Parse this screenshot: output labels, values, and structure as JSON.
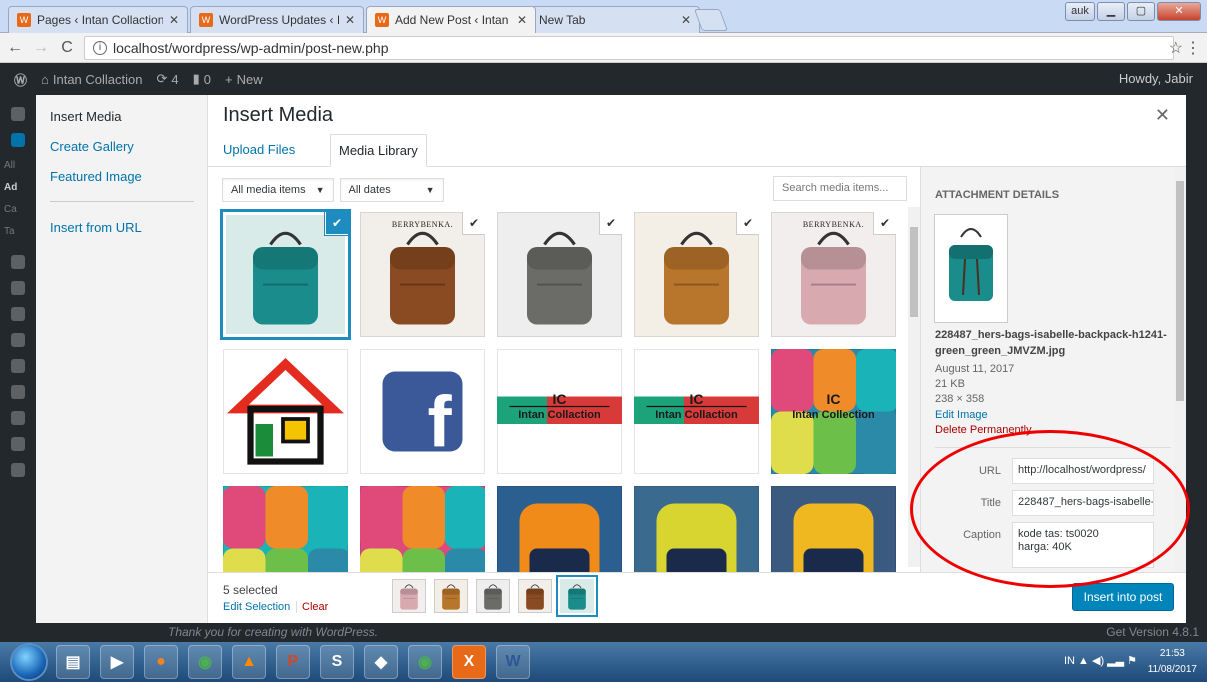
{
  "browser": {
    "tabs": [
      {
        "label": "Pages ‹ Intan Collaction -",
        "active": false
      },
      {
        "label": "WordPress Updates ‹ Inta",
        "active": false
      },
      {
        "label": "Add New Post ‹ Intan Co",
        "active": true
      },
      {
        "label": "New Tab",
        "active": false
      }
    ],
    "address": "localhost/wordpress/wp-admin/post-new.php",
    "profile_label": "auk"
  },
  "adminbar": {
    "site": "Intan Collaction",
    "updates": "4",
    "comments": "0",
    "new": "New",
    "howdy": "Howdy, Jabir"
  },
  "leftmenu_fragments": [
    "All",
    "Ad",
    "Ca",
    "Ta"
  ],
  "modal": {
    "title": "Insert Media",
    "sidebar": {
      "insert_media": "Insert Media",
      "create_gallery": "Create Gallery",
      "featured_image": "Featured Image",
      "insert_from_url": "Insert from URL"
    },
    "tabs": {
      "upload": "Upload Files",
      "library": "Media Library"
    },
    "filters": {
      "type": "All media items",
      "date": "All dates"
    },
    "search_placeholder": "Search media items...",
    "grid_items": [
      {
        "name": "isabelle-backpack-green",
        "bg": "#d8ebe9",
        "color": "#1a8c8c",
        "selected": true,
        "current": true
      },
      {
        "name": "berrybenka-brown-backpack",
        "bg": "#f2eeea",
        "color": "#8a4a22",
        "brand": "BERRYBENKA.",
        "selected": true
      },
      {
        "name": "grey-backpack",
        "bg": "#eeeeee",
        "color": "#6b6c68",
        "selected": true
      },
      {
        "name": "tan-leather-backpack",
        "bg": "#f4efe6",
        "color": "#b8752c",
        "selected": true
      },
      {
        "name": "berrybenka-pink-backpack",
        "bg": "#f3eeee",
        "color": "#d8aab0",
        "brand": "BERRYBENKA.",
        "selected": true
      },
      {
        "name": "house-logo",
        "bg": "#ffffff",
        "color": "#e32b20"
      },
      {
        "name": "facebook-logo",
        "bg": "#ffffff",
        "color": "#3b5998"
      },
      {
        "name": "intan-collaction-banner-1",
        "bg": "#ffffff",
        "color": "#1ca37a",
        "text": "Intan Collaction",
        "ic": "IC"
      },
      {
        "name": "intan-collaction-banner-2",
        "bg": "#ffffff",
        "color": "#1ca37a",
        "text": "Intan Collaction",
        "ic": "IC"
      },
      {
        "name": "colorful-backpacks-1",
        "bg": "#2a8aa8",
        "color": "#e8d24a",
        "text": "Intan Collection",
        "ic": "IC"
      },
      {
        "name": "colorful-backpacks-2",
        "bg": "#1ab4b8",
        "color": "#e0dd4d"
      },
      {
        "name": "colorful-backpacks-3",
        "bg": "#e04a7b",
        "color": "#f08b2a"
      },
      {
        "name": "orange-blue-backpack",
        "bg": "#2a5f8f",
        "color": "#f08b1a"
      },
      {
        "name": "yellow-green-backpack",
        "bg": "#3a6b8f",
        "color": "#d8d430"
      },
      {
        "name": "yellow-black-backpack",
        "bg": "#3a5a7f",
        "color": "#f0b820"
      }
    ],
    "details": {
      "heading": "ATTACHMENT DETAILS",
      "filename": "228487_hers-bags-isabelle-backpack-h1241-green_green_JMVZM.jpg",
      "date": "August 11, 2017",
      "size": "21 KB",
      "dimensions": "238 × 358",
      "edit": "Edit Image",
      "delete": "Delete Permanently",
      "url_label": "URL",
      "url_value": "http://localhost/wordpress/",
      "title_label": "Title",
      "title_value": "228487_hers-bags-isabelle-",
      "caption_label": "Caption",
      "caption_value": "kode tas: ts0020\nharga: 40K"
    },
    "toolbar": {
      "selected": "5 selected",
      "edit_selection": "Edit Selection",
      "clear": "Clear",
      "insert": "Insert into post"
    }
  },
  "footer": {
    "thanks": "Thank you for creating with WordPress.",
    "version": "Get Version 4.8.1"
  },
  "taskbar": {
    "lang": "IN",
    "time": "21:53",
    "date": "11/08/2017"
  },
  "colors": {
    "accent": "#0085ba",
    "link": "#0073aa",
    "annotation": "#e00000"
  }
}
